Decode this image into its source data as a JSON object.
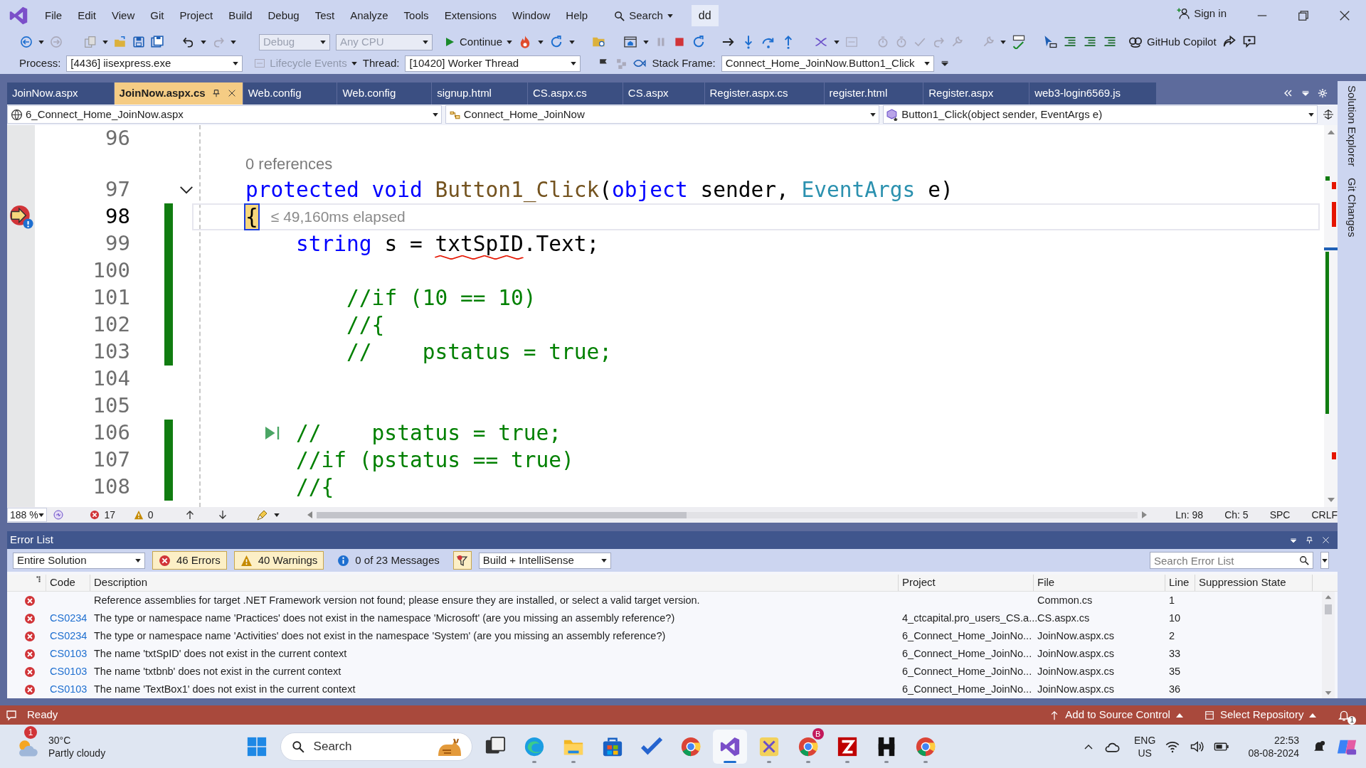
{
  "menu": [
    "File",
    "Edit",
    "View",
    "Git",
    "Project",
    "Build",
    "Debug",
    "Test",
    "Analyze",
    "Tools",
    "Extensions",
    "Window",
    "Help"
  ],
  "search": {
    "label": "Search"
  },
  "profile_initials": "dd",
  "sign_in": "Sign in",
  "toolbar": {
    "configuration": {
      "value": "Debug",
      "disabled": true
    },
    "platform": {
      "value": "Any CPU",
      "disabled": true
    },
    "continue": "Continue",
    "copilot": "GitHub Copilot"
  },
  "debug_location": {
    "process_label": "Process:",
    "process": "[4436] iisexpress.exe",
    "lifecycle": {
      "label": "Lifecycle Events",
      "disabled": true
    },
    "thread_label": "Thread:",
    "thread": "[10420] Worker Thread",
    "stack_frame_label": "Stack Frame:",
    "stack_frame": "Connect_Home_JoinNow.Button1_Click"
  },
  "tabs": [
    {
      "label": "JoinNow.aspx",
      "selected": false
    },
    {
      "label": "JoinNow.aspx.cs",
      "selected": true
    },
    {
      "label": "Web.config",
      "selected": false
    },
    {
      "label": "Web.config",
      "selected": false
    },
    {
      "label": "signup.html",
      "selected": false
    },
    {
      "label": "CS.aspx.cs",
      "selected": false
    },
    {
      "label": "CS.aspx",
      "selected": false
    },
    {
      "label": "Register.aspx.cs",
      "selected": false
    },
    {
      "label": "register.html",
      "selected": false
    },
    {
      "label": "Register.aspx",
      "selected": false
    },
    {
      "label": "web3-login6569.js",
      "selected": false
    }
  ],
  "navigation_bar": {
    "project": "6_Connect_Home_JoinNow.aspx",
    "type": "Connect_Home_JoinNow",
    "member": "Button1_Click(object sender, EventArgs e)"
  },
  "side_tabs": [
    "Solution Explorer",
    "Git Changes"
  ],
  "editor": {
    "lines": [
      {
        "number": "96",
        "current": false,
        "changed": false
      },
      {
        "number": "97",
        "current": false,
        "changed": false,
        "codelens": "0 references",
        "expanded": true,
        "tokens": [
          {
            "kind": "keyword",
            "text": "protected void"
          },
          {
            "kind": "method",
            "text": " Button1_Click"
          },
          {
            "kind": "plain",
            "text": "("
          },
          {
            "kind": "keyword",
            "text": "object"
          },
          {
            "kind": "plain",
            "text": " sender, "
          },
          {
            "kind": "type",
            "text": "EventArgs"
          },
          {
            "kind": "plain",
            "text": " e)"
          }
        ]
      },
      {
        "number": "98",
        "current": true,
        "changed": true,
        "hint": "≤ 49,160ms elapsed",
        "tokens": [
          {
            "kind": "brace",
            "text": "{"
          }
        ]
      },
      {
        "number": "99",
        "current": false,
        "changed": true,
        "tokens": [
          {
            "kind": "keyword",
            "text": "    string"
          },
          {
            "kind": "plain",
            "text": " s = "
          },
          {
            "kind": "error",
            "text": "txtSpID"
          },
          {
            "kind": "plain",
            "text": ".Text;"
          }
        ]
      },
      {
        "number": "100",
        "current": false,
        "changed": true
      },
      {
        "number": "101",
        "current": false,
        "changed": true,
        "tokens": [
          {
            "kind": "comment",
            "text": "        //if (10 == 10)"
          }
        ]
      },
      {
        "number": "102",
        "current": false,
        "changed": true,
        "tokens": [
          {
            "kind": "comment",
            "text": "        //{"
          }
        ]
      },
      {
        "number": "103",
        "current": false,
        "changed": true,
        "tokens": [
          {
            "kind": "comment",
            "text": "        //    pstatus = true;"
          }
        ]
      },
      {
        "number": "104",
        "current": false,
        "changed": false
      },
      {
        "number": "105",
        "current": false,
        "changed": false
      },
      {
        "number": "106",
        "current": false,
        "changed": true,
        "run_to_cursor": true,
        "tokens": [
          {
            "kind": "comment",
            "text": "    //    pstatus = true;"
          }
        ]
      },
      {
        "number": "107",
        "current": false,
        "changed": true,
        "tokens": [
          {
            "kind": "comment",
            "text": "    //if (pstatus == true)"
          }
        ]
      },
      {
        "number": "108",
        "current": false,
        "changed": true,
        "tokens": [
          {
            "kind": "comment",
            "text": "    //{"
          }
        ]
      }
    ]
  },
  "editor_status": {
    "zoom": "188 %",
    "errors": "17",
    "warnings": "0",
    "line": "Ln: 98",
    "column": "Ch: 5",
    "whitespace": "SPC",
    "line_ending": "CRLF"
  },
  "error_list": {
    "title": "Error List",
    "scope": "Entire Solution",
    "filters": [
      {
        "kind": "errors",
        "label": "46 Errors",
        "selected": true
      },
      {
        "kind": "warnings",
        "label": "40 Warnings",
        "selected": true
      },
      {
        "kind": "messages",
        "label": "0 of 23 Messages",
        "selected": false
      }
    ],
    "project_filter": {
      "selected": true
    },
    "source": "Build + IntelliSense",
    "search_placeholder": "Search Error List",
    "columns": [
      "Code",
      "Description",
      "Project",
      "File",
      "Line",
      "Suppression State"
    ],
    "rows": [
      {
        "kind": "error",
        "description": "Reference assemblies for target .NET Framework version not found; please ensure they are installed, or select a valid target version.",
        "file": "Common.cs",
        "line": "1"
      },
      {
        "kind": "error",
        "code": "CS0234",
        "description": "The type or namespace name 'Practices' does not exist in the namespace 'Microsoft' (are you missing an assembly reference?)",
        "project": "4_ctcapital.pro_users_CS.a...",
        "file": "CS.aspx.cs",
        "line": "10"
      },
      {
        "kind": "error",
        "code": "CS0234",
        "description": "The type or namespace name 'Activities' does not exist in the namespace 'System' (are you missing an assembly reference?)",
        "project": "6_Connect_Home_JoinNo...",
        "file": "JoinNow.aspx.cs",
        "line": "2"
      },
      {
        "kind": "error",
        "code": "CS0103",
        "description": "The name 'txtSpID' does not exist in the current context",
        "project": "6_Connect_Home_JoinNo...",
        "file": "JoinNow.aspx.cs",
        "line": "33"
      },
      {
        "kind": "error",
        "code": "CS0103",
        "description": "The name 'txtbnb' does not exist in the current context",
        "project": "6_Connect_Home_JoinNo...",
        "file": "JoinNow.aspx.cs",
        "line": "35"
      },
      {
        "kind": "error",
        "code": "CS0103",
        "description": "The name 'TextBox1' does not exist in the current context",
        "project": "6_Connect_Home_JoinNo...",
        "file": "JoinNow.aspx.cs",
        "line": "36"
      }
    ]
  },
  "status_bar": {
    "state": "Ready",
    "source_control": "Add to Source Control",
    "repository": "Select Repository",
    "notifications": "1"
  },
  "taskbar": {
    "weather": {
      "temperature": "30°C",
      "condition": "Partly cloudy",
      "badge": "1"
    },
    "search_placeholder": "Search",
    "apps": [
      {
        "kind": "task-view",
        "running": false,
        "selected": false
      },
      {
        "kind": "edge",
        "running": true,
        "selected": false
      },
      {
        "kind": "explorer",
        "running": true,
        "selected": false
      },
      {
        "kind": "store",
        "running": false,
        "selected": false
      },
      {
        "kind": "todo",
        "running": false,
        "selected": false
      },
      {
        "kind": "chrome",
        "running": false,
        "selected": false
      },
      {
        "kind": "visual-studio",
        "running": true,
        "selected": true
      },
      {
        "kind": "snipping",
        "running": true,
        "selected": false
      },
      {
        "kind": "chrome",
        "running": true,
        "selected": false,
        "badge": "B"
      },
      {
        "kind": "filezilla",
        "running": true,
        "selected": false
      },
      {
        "kind": "h-app",
        "running": true,
        "selected": false
      },
      {
        "kind": "chrome",
        "running": true,
        "selected": false
      }
    ],
    "language": "ENG",
    "region": "US",
    "time": "22:53",
    "date": "08-08-2024"
  }
}
